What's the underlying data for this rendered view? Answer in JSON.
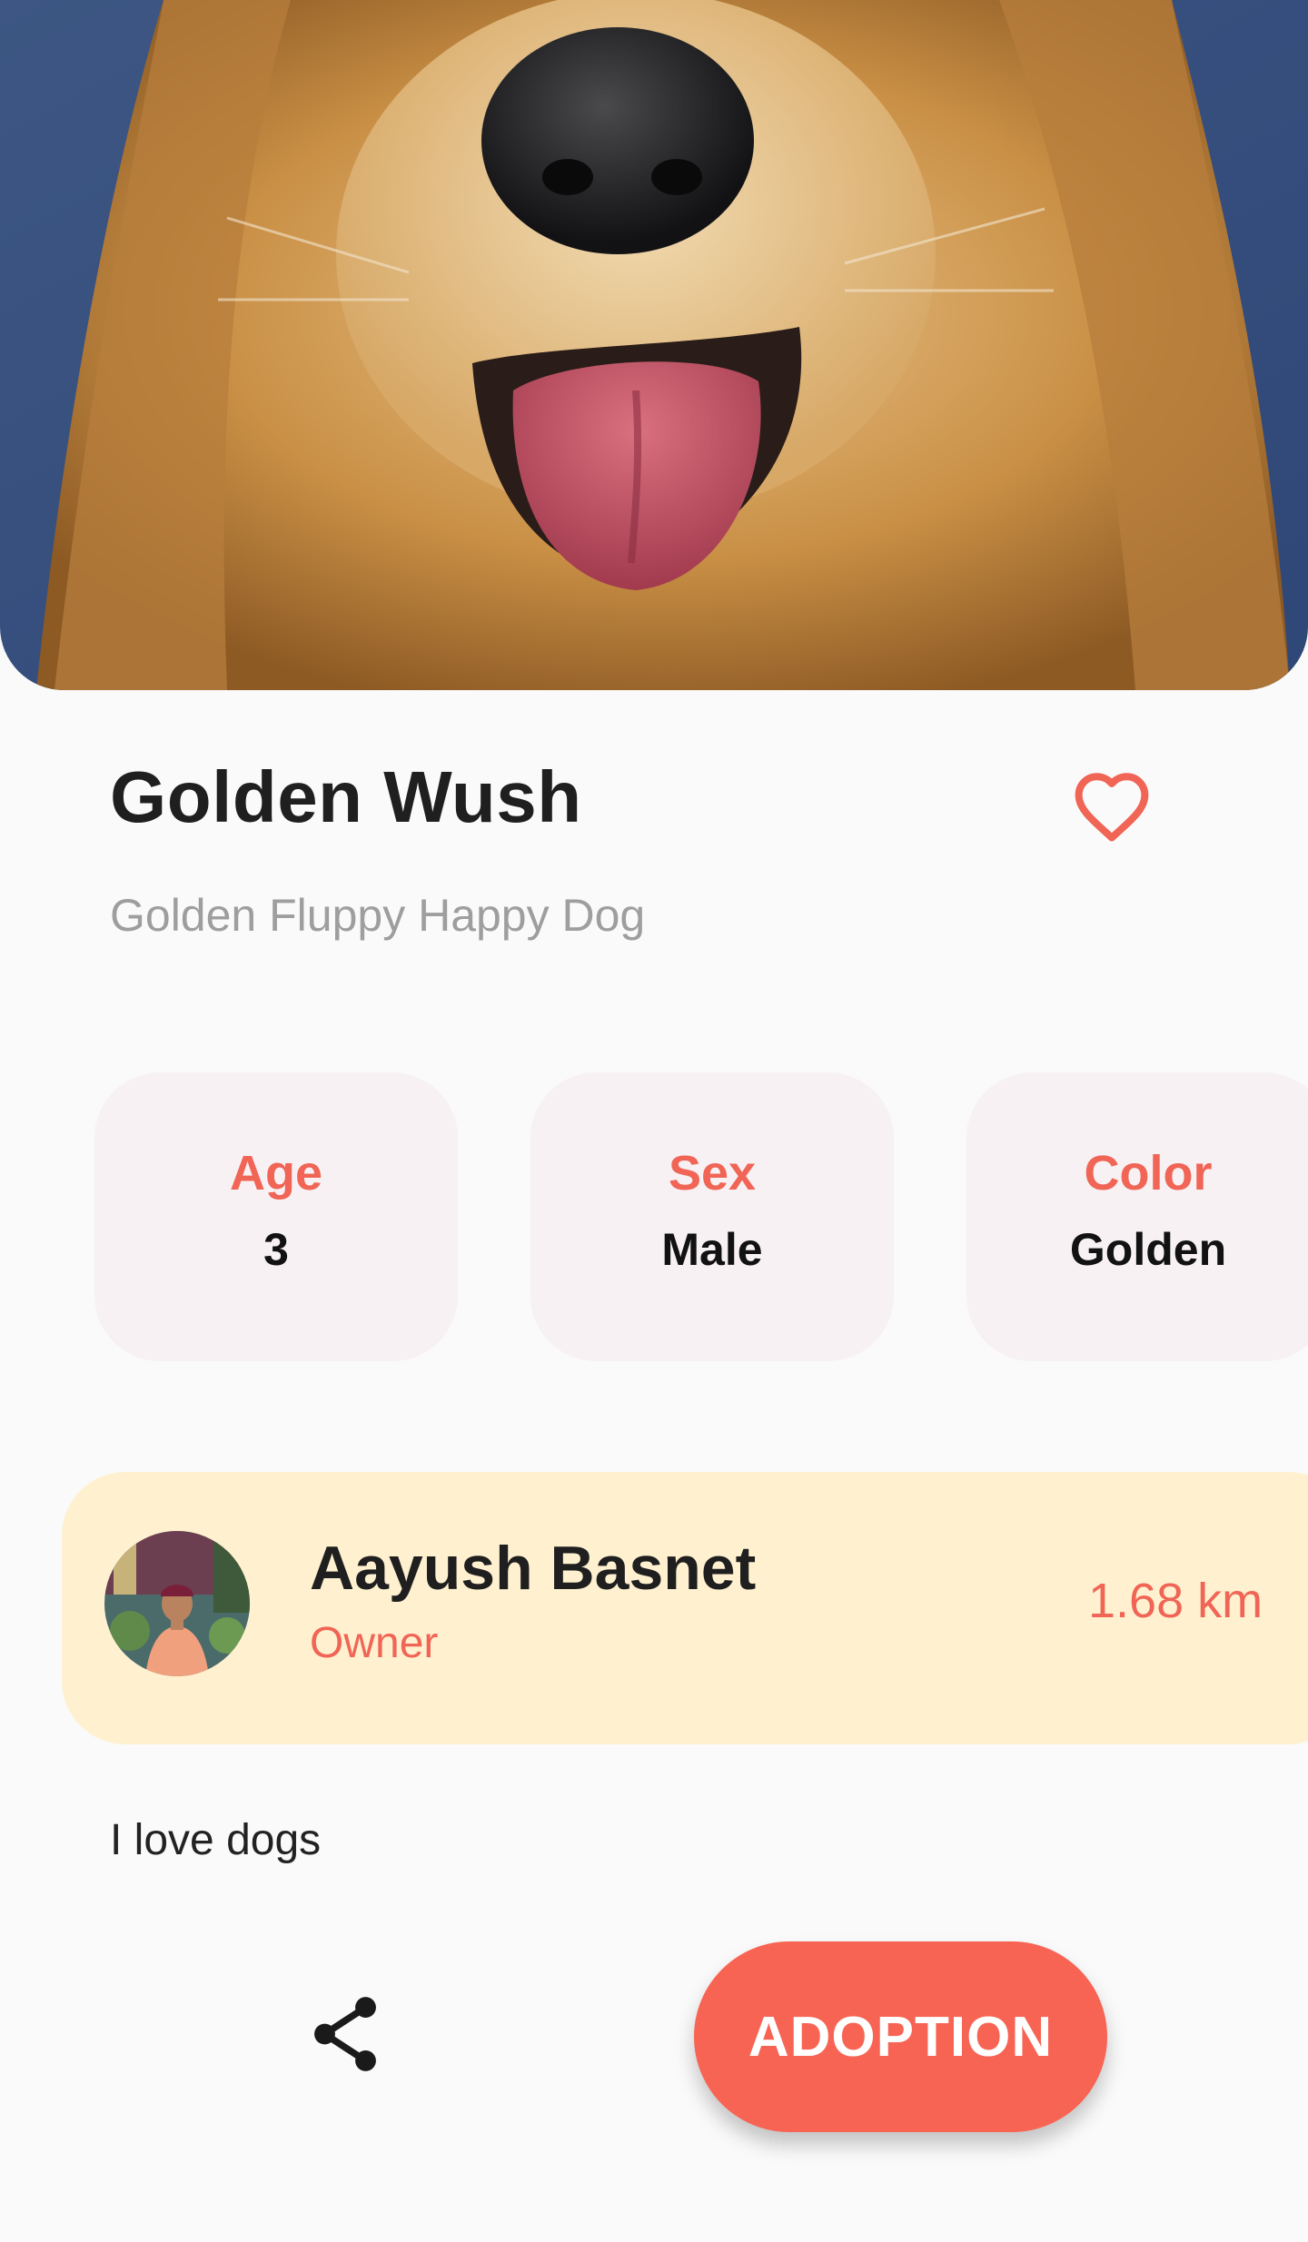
{
  "pet": {
    "name": "Golden Wush",
    "subtitle": "Golden Fluppy Happy Dog",
    "photo_icon": "dog-photo",
    "favorite_icon": "heart-outline-icon"
  },
  "attributes": [
    {
      "label": "Age",
      "value": "3"
    },
    {
      "label": "Sex",
      "value": "Male"
    },
    {
      "label": "Color",
      "value": "Golden"
    }
  ],
  "owner": {
    "name": "Aayush Basnet",
    "role": "Owner",
    "distance": "1.68 km",
    "avatar_icon": "owner-avatar-photo"
  },
  "bio": "I love dogs",
  "actions": {
    "share_icon": "share-icon",
    "adopt_label": "ADOPTION"
  },
  "colors": {
    "accent": "#f86454",
    "label_accent": "#f06555",
    "card_bg": "#f7f1f4",
    "owner_card_bg": "#fff1d0",
    "page_bg": "#fafafa"
  }
}
